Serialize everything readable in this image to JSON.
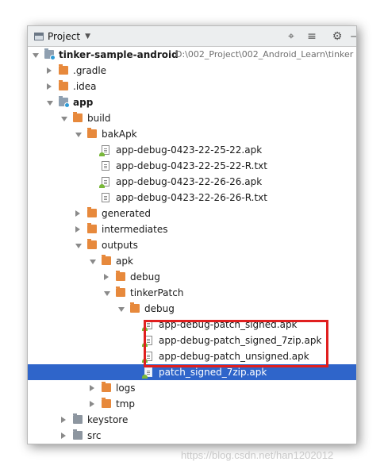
{
  "toolbar": {
    "title": "Project",
    "tools": [
      {
        "name": "locate-target-icon",
        "glyph": "⌖"
      },
      {
        "name": "collapse-all-icon",
        "glyph": "≡"
      },
      {
        "name": "settings-gear-icon",
        "glyph": "⚙"
      },
      {
        "name": "hide-panel-icon",
        "glyph": "‒"
      }
    ]
  },
  "tree": [
    {
      "label": "tinker-sample-android",
      "path": "D:\\002_Project\\002_Android_Learn\\tinker",
      "depth": 0,
      "arrow": "down",
      "icon": "module",
      "bold": true
    },
    {
      "label": ".gradle",
      "depth": 1,
      "arrow": "right",
      "icon": "folder-orange"
    },
    {
      "label": ".idea",
      "depth": 1,
      "arrow": "right",
      "icon": "folder-orange"
    },
    {
      "label": "app",
      "depth": 1,
      "arrow": "down",
      "icon": "module",
      "bold": true
    },
    {
      "label": "build",
      "depth": 2,
      "arrow": "down",
      "icon": "folder-orange"
    },
    {
      "label": "bakApk",
      "depth": 3,
      "arrow": "down",
      "icon": "folder-orange"
    },
    {
      "label": "app-debug-0423-22-25-22.apk",
      "depth": 4,
      "arrow": "none",
      "icon": "file-apk"
    },
    {
      "label": "app-debug-0423-22-25-22-R.txt",
      "depth": 4,
      "arrow": "none",
      "icon": "file-txt"
    },
    {
      "label": "app-debug-0423-22-26-26.apk",
      "depth": 4,
      "arrow": "none",
      "icon": "file-apk"
    },
    {
      "label": "app-debug-0423-22-26-26-R.txt",
      "depth": 4,
      "arrow": "none",
      "icon": "file-txt"
    },
    {
      "label": "generated",
      "depth": 3,
      "arrow": "right",
      "icon": "folder-orange"
    },
    {
      "label": "intermediates",
      "depth": 3,
      "arrow": "right",
      "icon": "folder-orange"
    },
    {
      "label": "outputs",
      "depth": 3,
      "arrow": "down",
      "icon": "folder-orange"
    },
    {
      "label": "apk",
      "depth": 4,
      "arrow": "down",
      "icon": "folder-orange"
    },
    {
      "label": "debug",
      "depth": 5,
      "arrow": "right",
      "icon": "folder-orange"
    },
    {
      "label": "tinkerPatch",
      "depth": 5,
      "arrow": "down",
      "icon": "folder-orange"
    },
    {
      "label": "debug",
      "depth": 6,
      "arrow": "down",
      "icon": "folder-orange"
    },
    {
      "label": "app-debug-patch_signed.apk",
      "depth": 7,
      "arrow": "none",
      "icon": "file-apk"
    },
    {
      "label": "app-debug-patch_signed_7zip.apk",
      "depth": 7,
      "arrow": "none",
      "icon": "file-apk"
    },
    {
      "label": "app-debug-patch_unsigned.apk",
      "depth": 7,
      "arrow": "none",
      "icon": "file-apk"
    },
    {
      "label": "patch_signed_7zip.apk",
      "depth": 7,
      "arrow": "none",
      "icon": "file-apk",
      "selected": true
    },
    {
      "label": "logs",
      "depth": 4,
      "arrow": "right",
      "icon": "folder-orange"
    },
    {
      "label": "tmp",
      "depth": 4,
      "arrow": "right",
      "icon": "folder-orange"
    },
    {
      "label": "keystore",
      "depth": 2,
      "arrow": "right",
      "icon": "folder-gray"
    },
    {
      "label": "src",
      "depth": 2,
      "arrow": "right",
      "icon": "folder-gray"
    }
  ],
  "colors": {
    "selection": "#2f65ca",
    "highlight_box": "#e01f1f",
    "folder": "#e7893c"
  },
  "watermark": "https://blog.csdn.net/han1202012"
}
